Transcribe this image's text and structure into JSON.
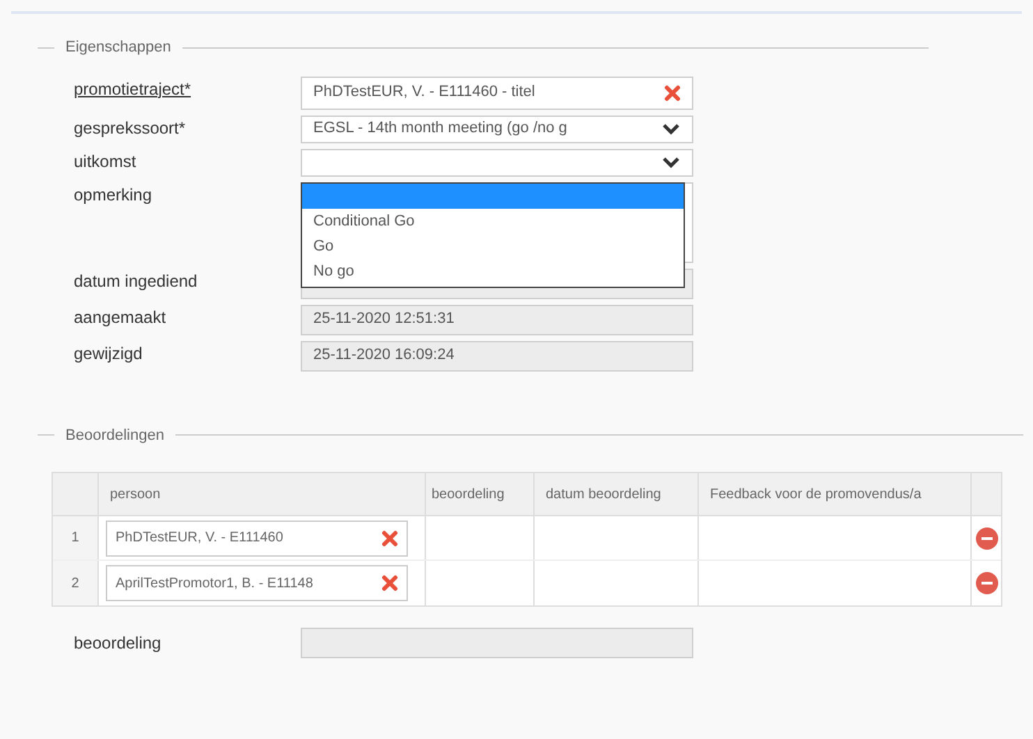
{
  "properties": {
    "legend": "Eigenschappen",
    "fields": [
      {
        "kind": "lookup",
        "label": "promotietraject*",
        "link": true,
        "value": "PhDTestEUR, V. - E111460 - titel"
      },
      {
        "kind": "select",
        "label": "gesprekssoort*",
        "value": "EGSL - 14th month meeting (go /no g"
      },
      {
        "kind": "select",
        "label": "uitkomst",
        "open": true,
        "options": [
          {
            "selected": true
          },
          {
            "label": "Conditional Go",
            "selected": false
          },
          {
            "label": "Go",
            "selected": false
          },
          {
            "label": "No go",
            "selected": false
          }
        ]
      },
      {
        "kind": "textarea",
        "label": "opmerking"
      },
      {
        "kind": "readonly",
        "label": "datum ingediend"
      },
      {
        "kind": "readonly",
        "label": "aangemaakt",
        "value": "25-11-2020 12:51:31"
      },
      {
        "kind": "readonly",
        "label": "gewijzigd",
        "value": "25-11-2020 16:09:24"
      }
    ]
  },
  "assessments": {
    "legend": "Beoordelingen",
    "columns": [
      "persoon",
      "beoordeling",
      "datum beoordeling",
      "Feedback voor de promovendus/a"
    ],
    "rows": [
      {
        "number": "1",
        "person": "PhDTestEUR, V. - E111460"
      },
      {
        "number": "2",
        "person": "AprilTestPromotor1, B. - E11148"
      }
    ],
    "summary": {
      "label": "beoordeling"
    }
  }
}
